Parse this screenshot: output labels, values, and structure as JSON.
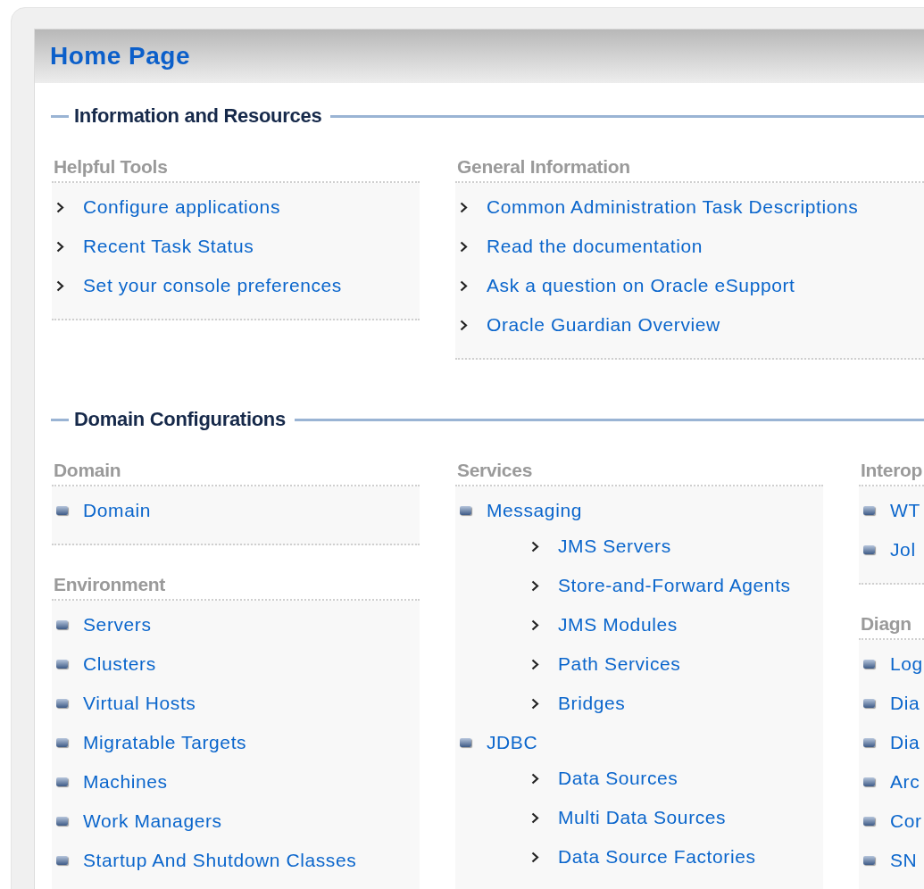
{
  "page_title": "Home Page",
  "sections": [
    {
      "title": "Information and Resources",
      "columns": [
        [
          {
            "title": "Helpful Tools",
            "items": [
              {
                "kind": "arrow",
                "label": "Configure applications"
              },
              {
                "kind": "arrow",
                "label": "Recent Task Status"
              },
              {
                "kind": "arrow",
                "label": "Set your console preferences"
              }
            ]
          }
        ],
        [
          {
            "title": "General Information",
            "items": [
              {
                "kind": "arrow",
                "label": "Common Administration Task Descriptions"
              },
              {
                "kind": "arrow",
                "label": "Read the documentation"
              },
              {
                "kind": "arrow",
                "label": "Ask a question on Oracle eSupport"
              },
              {
                "kind": "arrow",
                "label": "Oracle Guardian Overview"
              }
            ]
          }
        ]
      ]
    },
    {
      "title": "Domain Configurations",
      "columns": [
        [
          {
            "title": "Domain",
            "items": [
              {
                "kind": "bullet",
                "label": "Domain"
              }
            ]
          },
          {
            "title": "Environment",
            "items": [
              {
                "kind": "bullet",
                "label": "Servers"
              },
              {
                "kind": "bullet",
                "label": "Clusters"
              },
              {
                "kind": "bullet",
                "label": "Virtual Hosts"
              },
              {
                "kind": "bullet",
                "label": "Migratable Targets"
              },
              {
                "kind": "bullet",
                "label": "Machines"
              },
              {
                "kind": "bullet",
                "label": "Work Managers"
              },
              {
                "kind": "bullet",
                "label": "Startup And Shutdown Classes"
              }
            ]
          }
        ],
        [
          {
            "title": "Services",
            "items": [
              {
                "kind": "bullet",
                "label": "Messaging",
                "children": [
                  {
                    "kind": "arrow",
                    "label": "JMS Servers"
                  },
                  {
                    "kind": "arrow",
                    "label": "Store-and-Forward Agents"
                  },
                  {
                    "kind": "arrow",
                    "label": "JMS Modules"
                  },
                  {
                    "kind": "arrow",
                    "label": "Path Services"
                  },
                  {
                    "kind": "arrow",
                    "label": "Bridges"
                  }
                ]
              },
              {
                "kind": "bullet",
                "label": "JDBC",
                "children": [
                  {
                    "kind": "arrow",
                    "label": "Data Sources"
                  },
                  {
                    "kind": "arrow",
                    "label": "Multi Data Sources"
                  },
                  {
                    "kind": "arrow",
                    "label": "Data Source Factories"
                  }
                ]
              }
            ]
          }
        ],
        [
          {
            "title": "Interop",
            "items": [
              {
                "kind": "bullet",
                "label": "WT"
              },
              {
                "kind": "bullet",
                "label": "Jol"
              }
            ]
          },
          {
            "title": "Diagn",
            "items": [
              {
                "kind": "bullet",
                "label": "Log"
              },
              {
                "kind": "bullet",
                "label": "Dia"
              },
              {
                "kind": "bullet",
                "label": "Dia"
              },
              {
                "kind": "bullet",
                "label": "Arc"
              },
              {
                "kind": "bullet",
                "label": "Cor"
              },
              {
                "kind": "bullet",
                "label": "SN"
              }
            ]
          }
        ]
      ]
    }
  ]
}
